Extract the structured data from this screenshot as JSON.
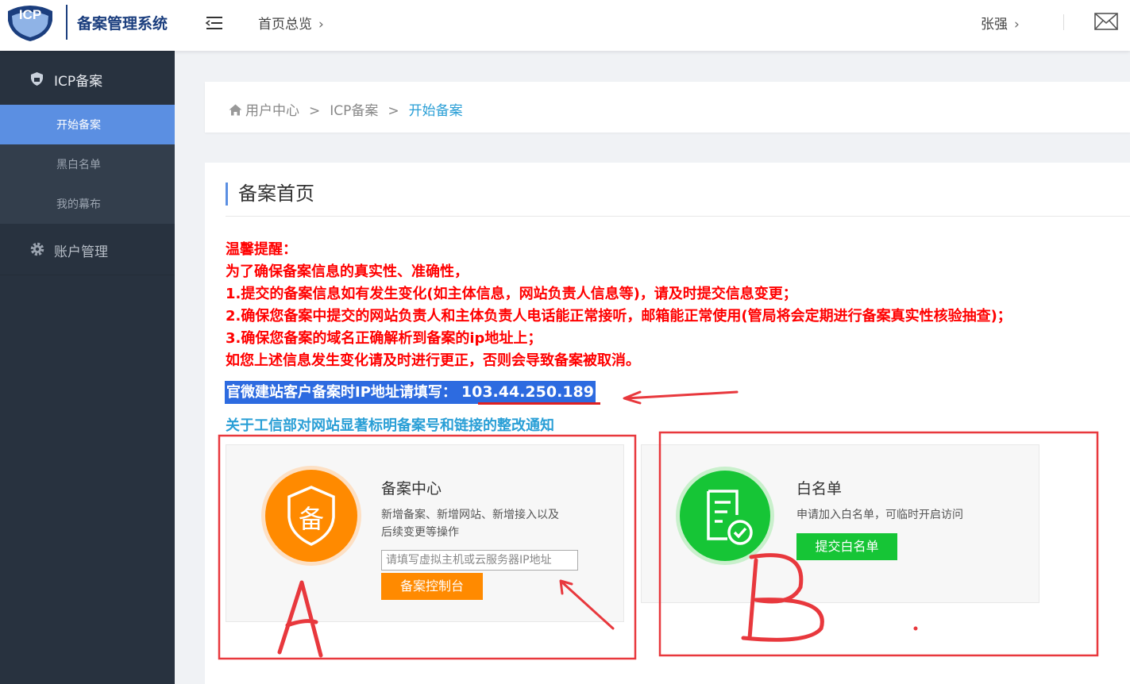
{
  "header": {
    "logo_badge": "ICP",
    "app_title": "备案管理系统",
    "nav_overview": "首页总览",
    "user_name": "张强",
    "chevron": "›"
  },
  "sidebar": {
    "groups": [
      {
        "label": "ICP备案",
        "icon": "shield-icon"
      },
      {
        "label": "账户管理",
        "icon": "gear-icon"
      }
    ],
    "items": [
      {
        "label": "开始备案",
        "active": true
      },
      {
        "label": "黑白名单",
        "active": false
      },
      {
        "label": "我的幕布",
        "active": false
      }
    ],
    "active_color": "#5b8fe2"
  },
  "breadcrumb": {
    "home": "用户中心",
    "sep": ">",
    "level2": "ICP备案",
    "current": "开始备案"
  },
  "main": {
    "title": "备案首页",
    "notice_lines": [
      "温馨提醒：",
      "为了确保备案信息的真实性、准确性，",
      "1.提交的备案信息如有发生变化(如主体信息，网站负责人信息等)，请及时提交信息变更；",
      "2.确保您备案中提交的网站负责人和主体负责人电话能正常接听，邮箱能正常使用(管局将会定期进行备案真实性核验抽查)；",
      "3.确保您备案的域名正确解析到备案的ip地址上；",
      "如您上述信息发生变化请及时进行更正，否则会导致备案被取消。"
    ],
    "ip_label": "官微建站客户备案时IP地址请填写：",
    "ip_value": "103.44.250.189",
    "notice_link": "关于工信部对网站显著标明备案号和链接的整改通知"
  },
  "cards": {
    "filing": {
      "icon_char": "备",
      "title": "备案中心",
      "desc_line1": "新增备案、新增网站、新增接入以及",
      "desc_line2": "后续变更等操作",
      "input_placeholder": "请填写虚拟主机或云服务器IP地址",
      "input_value": "",
      "button": "备案控制台"
    },
    "whitelist": {
      "title": "白名单",
      "desc": "申请加入白名单，可临时开启访问",
      "button": "提交白名单"
    }
  },
  "annotations": {
    "label_a": "A",
    "label_b": "B",
    "color": "#e8383d"
  },
  "colors": {
    "accent_blue": "#2a9fd6",
    "notice_red": "#ff0000",
    "orange": "#ff8a00",
    "green": "#16c536",
    "sidebar_bg": "#28323f"
  }
}
